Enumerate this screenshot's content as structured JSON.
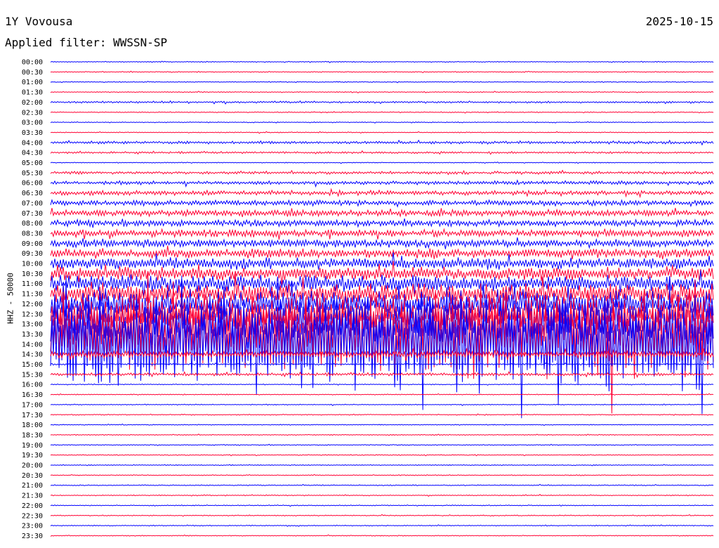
{
  "header": {
    "station": "1Y Vovousa",
    "date": "2025-10-15",
    "filter": "Applied filter: WWSSN-SP"
  },
  "chart_data": {
    "type": "line",
    "title": "1Y Vovousa",
    "subtitle": "Applied filter: WWSSN-SP",
    "ylabel": "HHZ - 50000",
    "xlabel": "",
    "colors": [
      "#0000ff",
      "#ff0033"
    ],
    "grid": false,
    "rows": [
      {
        "label": "00:00",
        "amplitude": 1
      },
      {
        "label": "00:30",
        "amplitude": 1
      },
      {
        "label": "01:00",
        "amplitude": 1
      },
      {
        "label": "01:30",
        "amplitude": 1
      },
      {
        "label": "02:00",
        "amplitude": 2
      },
      {
        "label": "02:30",
        "amplitude": 1
      },
      {
        "label": "03:00",
        "amplitude": 1
      },
      {
        "label": "03:30",
        "amplitude": 1
      },
      {
        "label": "04:00",
        "amplitude": 3
      },
      {
        "label": "04:30",
        "amplitude": 2
      },
      {
        "label": "05:00",
        "amplitude": 1
      },
      {
        "label": "05:30",
        "amplitude": 3
      },
      {
        "label": "06:00",
        "amplitude": 4
      },
      {
        "label": "06:30",
        "amplitude": 5
      },
      {
        "label": "07:00",
        "amplitude": 6
      },
      {
        "label": "07:30",
        "amplitude": 7
      },
      {
        "label": "08:00",
        "amplitude": 7
      },
      {
        "label": "08:30",
        "amplitude": 8
      },
      {
        "label": "09:00",
        "amplitude": 9
      },
      {
        "label": "09:30",
        "amplitude": 10
      },
      {
        "label": "10:00",
        "amplitude": 12
      },
      {
        "label": "10:30",
        "amplitude": 14
      },
      {
        "label": "11:00",
        "amplitude": 18
      },
      {
        "label": "11:30",
        "amplitude": 22
      },
      {
        "label": "12:00",
        "amplitude": 30
      },
      {
        "label": "12:30",
        "amplitude": 40
      },
      {
        "label": "13:00",
        "amplitude": 60
      },
      {
        "label": "13:30",
        "amplitude": 90
      },
      {
        "label": "14:00",
        "amplitude": 100
      },
      {
        "label": "14:30",
        "amplitude": 8
      },
      {
        "label": "15:00",
        "amplitude": 2
      },
      {
        "label": "15:30",
        "amplitude": 3
      },
      {
        "label": "16:00",
        "amplitude": 1
      },
      {
        "label": "16:30",
        "amplitude": 1
      },
      {
        "label": "17:00",
        "amplitude": 1
      },
      {
        "label": "17:30",
        "amplitude": 1
      },
      {
        "label": "18:00",
        "amplitude": 1
      },
      {
        "label": "18:30",
        "amplitude": 1
      },
      {
        "label": "19:00",
        "amplitude": 1
      },
      {
        "label": "19:30",
        "amplitude": 1
      },
      {
        "label": "20:00",
        "amplitude": 1
      },
      {
        "label": "20:30",
        "amplitude": 1
      },
      {
        "label": "21:00",
        "amplitude": 1
      },
      {
        "label": "21:30",
        "amplitude": 1
      },
      {
        "label": "22:00",
        "amplitude": 1
      },
      {
        "label": "22:30",
        "amplitude": 1
      },
      {
        "label": "23:00",
        "amplitude": 1
      },
      {
        "label": "23:30",
        "amplitude": 1
      }
    ]
  }
}
